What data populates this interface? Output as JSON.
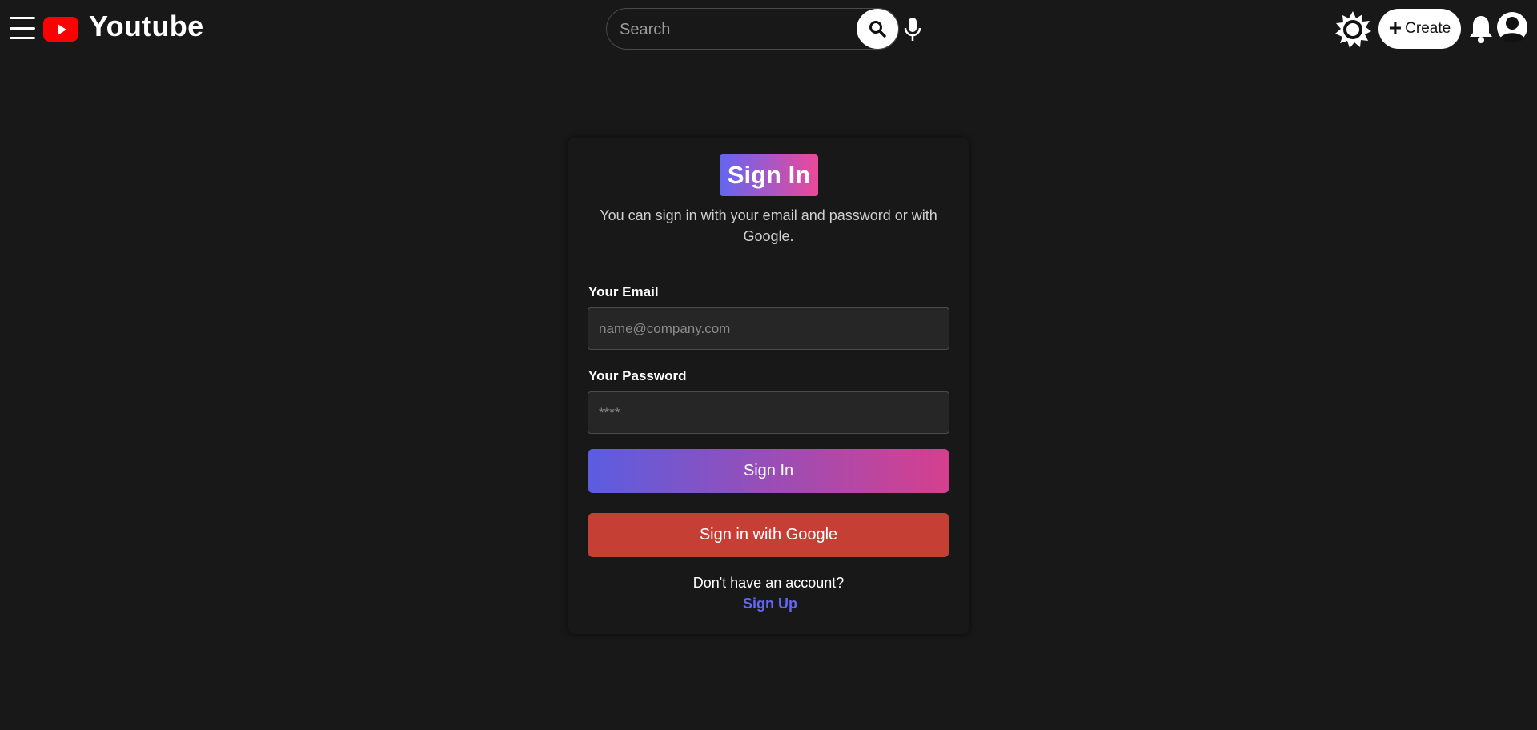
{
  "header": {
    "logo_text": "Youtube",
    "search_placeholder": "Search",
    "create_label": "Create",
    "icons": {
      "menu": "hamburger-menu-icon",
      "logo": "youtube-play-icon",
      "search": "search-icon",
      "mic": "microphone-icon",
      "theme": "sun-icon",
      "create": "plus-icon",
      "notifications": "bell-icon",
      "account": "user-icon"
    }
  },
  "signin": {
    "title": "Sign In",
    "subtitle": "You can sign in with your email and password or with Google.",
    "email_label": "Your Email",
    "email_placeholder": "name@company.com",
    "email_value": "",
    "password_label": "Your Password",
    "password_placeholder": "****",
    "password_value": "",
    "submit_label": "Sign In",
    "google_label": "Sign in with Google",
    "no_account_text": "Don't have an account?",
    "signup_label": "Sign Up"
  },
  "colors": {
    "background": "#181818",
    "brand_red": "#ff0000",
    "gradient_start": "#6366f1",
    "gradient_end": "#ec4899",
    "google_button": "#c53f35",
    "link": "#6366f1"
  }
}
